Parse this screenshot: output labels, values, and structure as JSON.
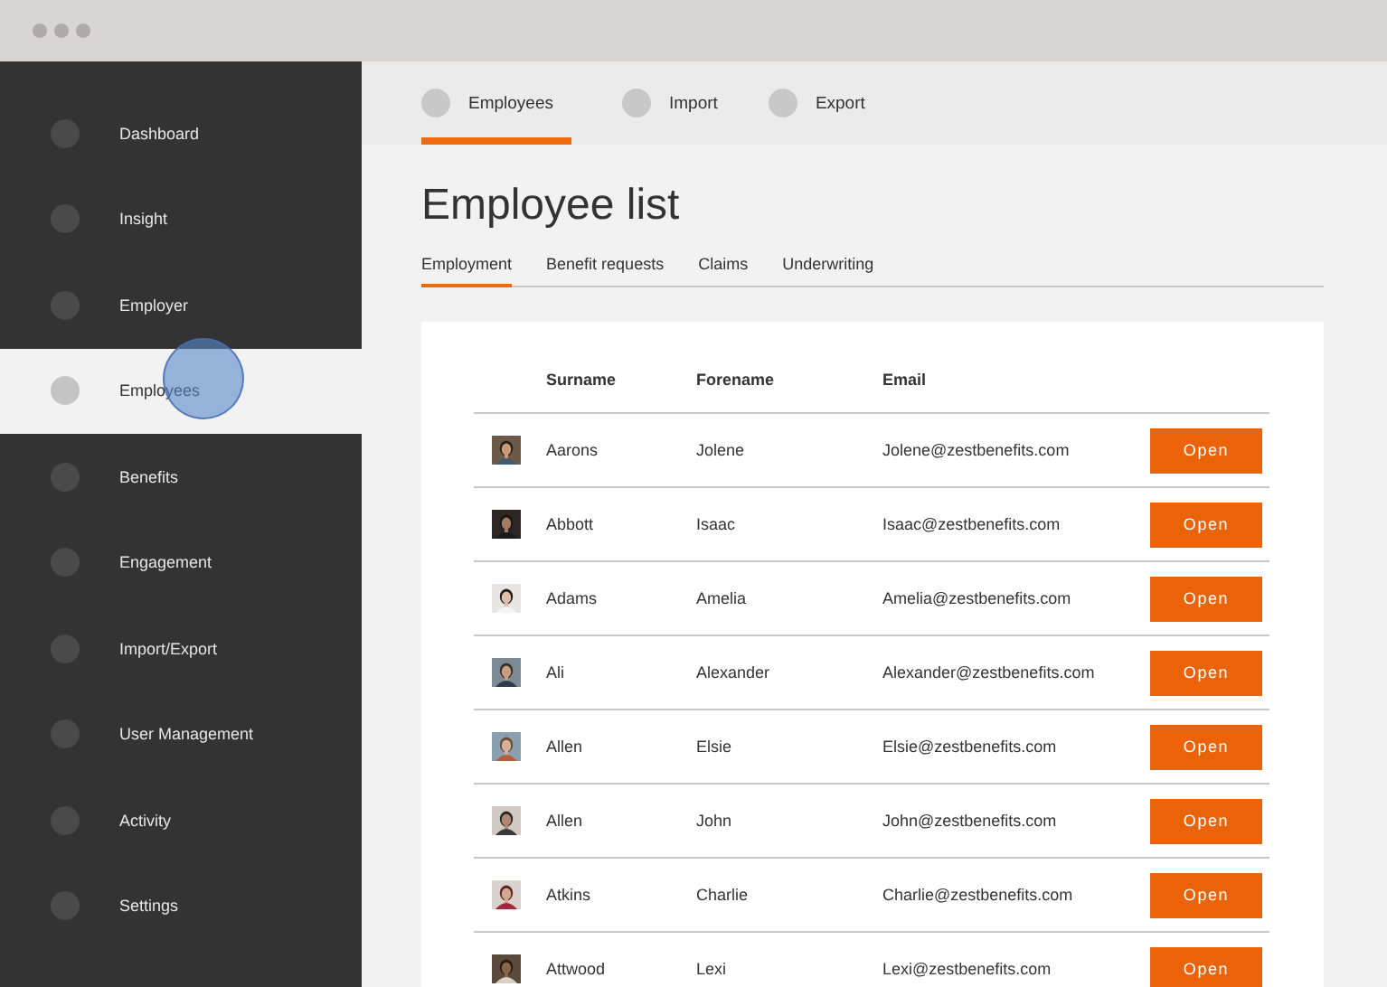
{
  "sidebar": {
    "items": [
      {
        "label": "Dashboard",
        "selected": false
      },
      {
        "label": "Insight",
        "selected": false
      },
      {
        "label": "Employer",
        "selected": false
      },
      {
        "label": "Employees",
        "selected": true
      },
      {
        "label": "Benefits",
        "selected": false
      },
      {
        "label": "Engagement",
        "selected": false
      },
      {
        "label": "Import/Export",
        "selected": false
      },
      {
        "label": "User Management",
        "selected": false
      },
      {
        "label": "Activity",
        "selected": false
      },
      {
        "label": "Settings",
        "selected": false
      }
    ]
  },
  "top_tabs": [
    {
      "label": "Employees",
      "selected": true
    },
    {
      "label": "Import",
      "selected": false
    },
    {
      "label": "Export",
      "selected": false
    }
  ],
  "page_title": "Employee list",
  "sub_tabs": [
    {
      "label": "Employment",
      "selected": true
    },
    {
      "label": "Benefit requests",
      "selected": false
    },
    {
      "label": "Claims",
      "selected": false
    },
    {
      "label": "Underwriting",
      "selected": false
    }
  ],
  "table": {
    "columns": [
      "Surname",
      "Forename",
      "Email"
    ],
    "rows": [
      {
        "surname": "Aarons",
        "forename": "Jolene",
        "email": "Jolene@zestbenefits.com",
        "action": "Open"
      },
      {
        "surname": "Abbott",
        "forename": "Isaac",
        "email": "Isaac@zestbenefits.com",
        "action": "Open"
      },
      {
        "surname": "Adams",
        "forename": "Amelia",
        "email": "Amelia@zestbenefits.com",
        "action": "Open"
      },
      {
        "surname": "Ali",
        "forename": "Alexander",
        "email": "Alexander@zestbenefits.com",
        "action": "Open"
      },
      {
        "surname": "Allen",
        "forename": "Elsie",
        "email": "Elsie@zestbenefits.com",
        "action": "Open"
      },
      {
        "surname": "Allen",
        "forename": "John",
        "email": "John@zestbenefits.com",
        "action": "Open"
      },
      {
        "surname": "Atkins",
        "forename": "Charlie",
        "email": "Charlie@zestbenefits.com",
        "action": "Open"
      },
      {
        "surname": "Attwood",
        "forename": "Lexi",
        "email": "Lexi@zestbenefits.com",
        "action": "Open"
      }
    ]
  }
}
